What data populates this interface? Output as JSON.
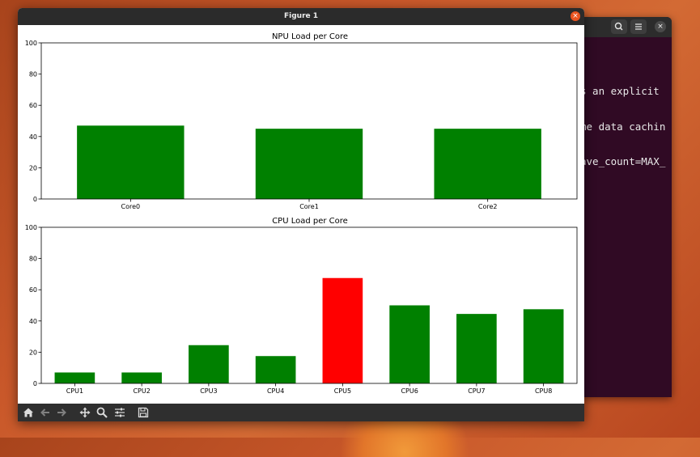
{
  "window": {
    "title": "Figure 1",
    "close_glyph": "×"
  },
  "terminal": {
    "lines": [
      "s an explicit",
      "me data cachin",
      "ave_count=MAX_"
    ],
    "search_icon": "search-icon",
    "menu_icon": "hamburger-menu-icon",
    "close_glyph": "×",
    "background": "#300a24"
  },
  "toolbar": {
    "buttons": [
      {
        "icon": "home-icon",
        "enabled": true
      },
      {
        "icon": "back-arrow-icon",
        "enabled": false
      },
      {
        "icon": "forward-arrow-icon",
        "enabled": false
      },
      {
        "icon": "pan-move-icon",
        "enabled": true
      },
      {
        "icon": "zoom-magnifier-icon",
        "enabled": true
      },
      {
        "icon": "configure-subplots-icon",
        "enabled": true
      },
      {
        "icon": "save-floppy-icon",
        "enabled": true
      }
    ]
  },
  "colors": {
    "normal_bar": "#008000",
    "high_bar": "#ff0000",
    "close_button": "#e95420"
  },
  "chart_data": [
    {
      "type": "bar",
      "title": "NPU Load per Core",
      "categories": [
        "Core0",
        "Core1",
        "Core2"
      ],
      "values": [
        47,
        45,
        45
      ],
      "colors": [
        "#008000",
        "#008000",
        "#008000"
      ],
      "ylim": [
        0,
        100
      ],
      "yticks": [
        0,
        20,
        40,
        60,
        80,
        100
      ],
      "xlabel": "",
      "ylabel": "",
      "grid": false
    },
    {
      "type": "bar",
      "title": "CPU Load per Core",
      "categories": [
        "CPU1",
        "CPU2",
        "CPU3",
        "CPU4",
        "CPU5",
        "CPU6",
        "CPU7",
        "CPU8"
      ],
      "values": [
        7,
        7,
        24.5,
        17.5,
        67.5,
        50,
        44.5,
        47.5
      ],
      "colors": [
        "#008000",
        "#008000",
        "#008000",
        "#008000",
        "#ff0000",
        "#008000",
        "#008000",
        "#008000"
      ],
      "ylim": [
        0,
        100
      ],
      "yticks": [
        0,
        20,
        40,
        60,
        80,
        100
      ],
      "xlabel": "",
      "ylabel": "",
      "grid": false
    }
  ]
}
